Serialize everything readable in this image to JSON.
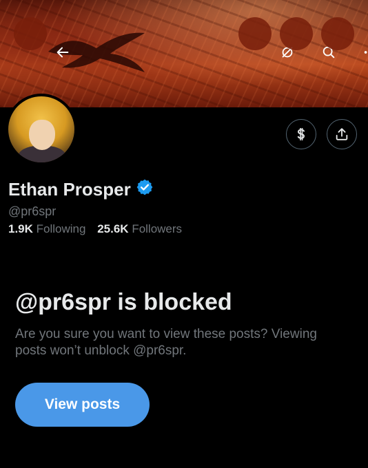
{
  "header": {
    "back_icon": "arrow-left-icon",
    "grok_icon": "slashed-circle-icon",
    "search_icon": "search-icon",
    "more_icon": "ellipsis-icon"
  },
  "profile": {
    "name": "Ethan Prosper",
    "handle": "@pr6spr",
    "verified": true,
    "following_count": "1.9K",
    "following_label": "Following",
    "followers_count": "25.6K",
    "followers_label": "Followers",
    "tip_icon": "dollar-sign-icon",
    "share_icon": "share-upload-icon"
  },
  "blocked": {
    "title": "@pr6spr is blocked",
    "description": "Are you sure you want to view these posts? Viewing posts won’t unblock @pr6spr.",
    "button_label": "View posts"
  },
  "colors": {
    "background": "#000000",
    "primary_text": "#e7e9ea",
    "secondary_text": "#71767b",
    "accent_button": "#4a98e8",
    "verified_badge": "#1d9bf0",
    "header_button_bg": "#7a1e0a"
  }
}
